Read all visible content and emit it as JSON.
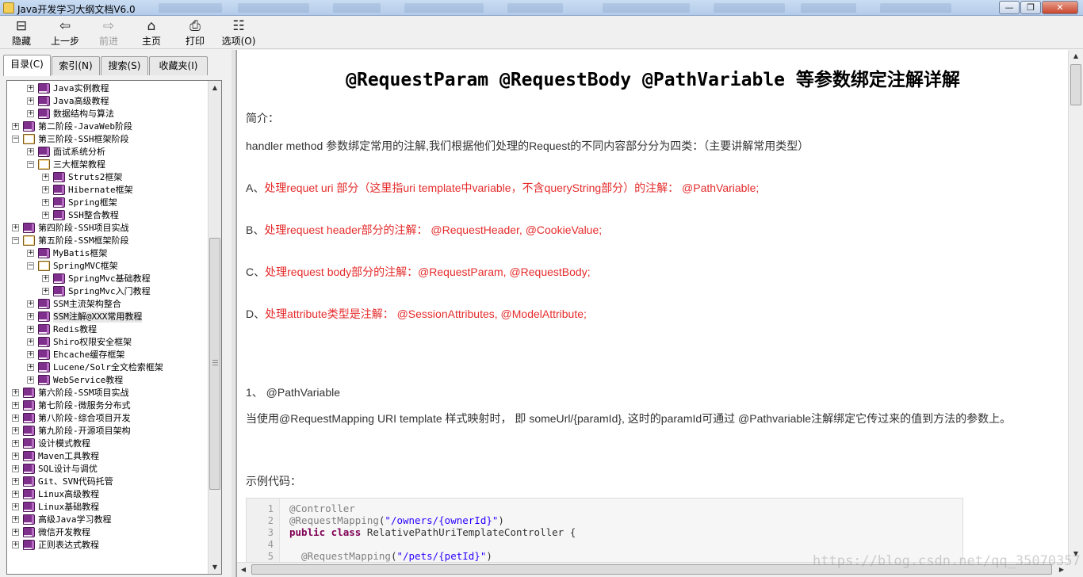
{
  "window": {
    "title": "Java开发学习大纲文档V6.0",
    "controls": [
      "—",
      "❐",
      "✕"
    ]
  },
  "toolbar": {
    "buttons": [
      {
        "label": "隐藏",
        "icon": "hide-icon",
        "glyph": "⊟",
        "enabled": true
      },
      {
        "label": "上一步",
        "icon": "back-arrow-icon",
        "glyph": "⇦",
        "enabled": true
      },
      {
        "label": "前进",
        "icon": "forward-arrow-icon",
        "glyph": "⇨",
        "enabled": false
      },
      {
        "label": "主页",
        "icon": "home-icon",
        "glyph": "⌂",
        "enabled": true
      },
      {
        "label": "打印",
        "icon": "printer-icon",
        "glyph": "⎙",
        "enabled": true
      },
      {
        "label": "选项(O)",
        "icon": "options-icon",
        "glyph": "☷",
        "enabled": true
      }
    ]
  },
  "tabs": [
    {
      "label": "目录(C)",
      "active": true
    },
    {
      "label": "索引(N)",
      "active": false
    },
    {
      "label": "搜索(S)",
      "active": false
    },
    {
      "label": "收藏夹(I)",
      "active": false
    }
  ],
  "tree": [
    {
      "label": "Java实例教程",
      "level": 1,
      "expander": "+",
      "icon": "closed"
    },
    {
      "label": "Java高级教程",
      "level": 1,
      "expander": "+",
      "icon": "closed"
    },
    {
      "label": "数据结构与算法",
      "level": 1,
      "expander": "+",
      "icon": "closed"
    },
    {
      "label": "第二阶段-JavaWeb阶段",
      "level": 0,
      "expander": "+",
      "icon": "closed"
    },
    {
      "label": "第三阶段-SSH框架阶段",
      "level": 0,
      "expander": "−",
      "icon": "open"
    },
    {
      "label": "面试系统分析",
      "level": 1,
      "expander": "+",
      "icon": "closed"
    },
    {
      "label": "三大框架教程",
      "level": 1,
      "expander": "−",
      "icon": "open"
    },
    {
      "label": "Struts2框架",
      "level": 2,
      "expander": "+",
      "icon": "closed"
    },
    {
      "label": "Hibernate框架",
      "level": 2,
      "expander": "+",
      "icon": "closed"
    },
    {
      "label": "Spring框架",
      "level": 2,
      "expander": "+",
      "icon": "closed"
    },
    {
      "label": "SSH整合教程",
      "level": 2,
      "expander": "+",
      "icon": "closed"
    },
    {
      "label": "第四阶段-SSH项目实战",
      "level": 0,
      "expander": "+",
      "icon": "closed"
    },
    {
      "label": "第五阶段-SSM框架阶段",
      "level": 0,
      "expander": "−",
      "icon": "open"
    },
    {
      "label": "MyBatis框架",
      "level": 1,
      "expander": "+",
      "icon": "closed"
    },
    {
      "label": "SpringMVC框架",
      "level": 1,
      "expander": "−",
      "icon": "open"
    },
    {
      "label": "SpringMvc基础教程",
      "level": 2,
      "expander": "+",
      "icon": "closed"
    },
    {
      "label": "SpringMvc入门教程",
      "level": 2,
      "expander": "+",
      "icon": "closed"
    },
    {
      "label": "SSM主流架构整合",
      "level": 1,
      "expander": "+",
      "icon": "closed"
    },
    {
      "label": "SSM注解@XXX常用教程",
      "level": 1,
      "expander": "+",
      "icon": "closed",
      "selected": true
    },
    {
      "label": "Redis教程",
      "level": 1,
      "expander": "+",
      "icon": "closed"
    },
    {
      "label": "Shiro权限安全框架",
      "level": 1,
      "expander": "+",
      "icon": "closed"
    },
    {
      "label": "Ehcache缓存框架",
      "level": 1,
      "expander": "+",
      "icon": "closed"
    },
    {
      "label": "Lucene/Solr全文检索框架",
      "level": 1,
      "expander": "+",
      "icon": "closed"
    },
    {
      "label": "WebService教程",
      "level": 1,
      "expander": "+",
      "icon": "closed"
    },
    {
      "label": "第六阶段-SSM项目实战",
      "level": 0,
      "expander": "+",
      "icon": "closed"
    },
    {
      "label": "第七阶段-微服务分布式",
      "level": 0,
      "expander": "+",
      "icon": "closed"
    },
    {
      "label": "第八阶段-综合项目开发",
      "level": 0,
      "expander": "+",
      "icon": "closed"
    },
    {
      "label": "第九阶段-开源项目架构",
      "level": 0,
      "expander": "+",
      "icon": "closed"
    },
    {
      "label": "设计模式教程",
      "level": 0,
      "expander": "+",
      "icon": "closed"
    },
    {
      "label": "Maven工具教程",
      "level": 0,
      "expander": "+",
      "icon": "closed"
    },
    {
      "label": "SQL设计与调优",
      "level": 0,
      "expander": "+",
      "icon": "closed"
    },
    {
      "label": "Git、SVN代码托管",
      "level": 0,
      "expander": "+",
      "icon": "closed"
    },
    {
      "label": "Linux高级教程",
      "level": 0,
      "expander": "+",
      "icon": "closed"
    },
    {
      "label": "Linux基础教程",
      "level": 0,
      "expander": "+",
      "icon": "closed"
    },
    {
      "label": "高级Java学习教程",
      "level": 0,
      "expander": "+",
      "icon": "closed"
    },
    {
      "label": "微信开发教程",
      "level": 0,
      "expander": "+",
      "icon": "closed"
    },
    {
      "label": "正则表达式教程",
      "level": 0,
      "expander": "+",
      "icon": "closed"
    }
  ],
  "article": {
    "title": "@RequestParam @RequestBody @PathVariable 等参数绑定注解详解",
    "intro_label": "简介：",
    "intro_text": "handler method 参数绑定常用的注解,我们根据他们处理的Request的不同内容部分分为四类：（主要讲解常用类型）",
    "items": [
      {
        "lead": "A、",
        "text": "处理requet uri 部分（这里指uri template中variable，不含queryString部分）的注解：  @PathVariable;"
      },
      {
        "lead": "B、",
        "text": "处理request header部分的注解：  @RequestHeader, @CookieValue;"
      },
      {
        "lead": "C、",
        "text": "处理request body部分的注解：@RequestParam,  @RequestBody;"
      },
      {
        "lead": "D、",
        "text": "处理attribute类型是注解： @SessionAttributes, @ModelAttribute;"
      }
    ],
    "section_heading": "1、 @PathVariable",
    "section_text": "当使用@RequestMapping URI template 样式映射时， 即 someUrl/{paramId}, 这时的paramId可通过 @Pathvariable注解绑定它传过来的值到方法的参数上。",
    "example_label": "示例代码：",
    "code_lines": [
      {
        "n": "1",
        "segments": [
          {
            "t": "@Controller",
            "c": "ann"
          }
        ]
      },
      {
        "n": "2",
        "segments": [
          {
            "t": "@RequestMapping",
            "c": "ann"
          },
          {
            "t": "(",
            "c": ""
          },
          {
            "t": "\"/owners/{ownerId}\"",
            "c": "str"
          },
          {
            "t": ")",
            "c": ""
          }
        ]
      },
      {
        "n": "3",
        "segments": [
          {
            "t": "public class",
            "c": "kw"
          },
          {
            "t": " RelativePathUriTemplateController {",
            "c": ""
          }
        ]
      },
      {
        "n": "4",
        "segments": []
      },
      {
        "n": "5",
        "segments": [
          {
            "t": "  @RequestMapping",
            "c": "ann"
          },
          {
            "t": "(",
            "c": ""
          },
          {
            "t": "\"/pets/{petId}\"",
            "c": "str"
          },
          {
            "t": ")",
            "c": ""
          }
        ]
      }
    ]
  },
  "watermark": "https://blog.csdn.net/qq_35070357",
  "colors": {
    "highlight_red": "#e52b2b",
    "book_purple": "#7f2f8c"
  }
}
